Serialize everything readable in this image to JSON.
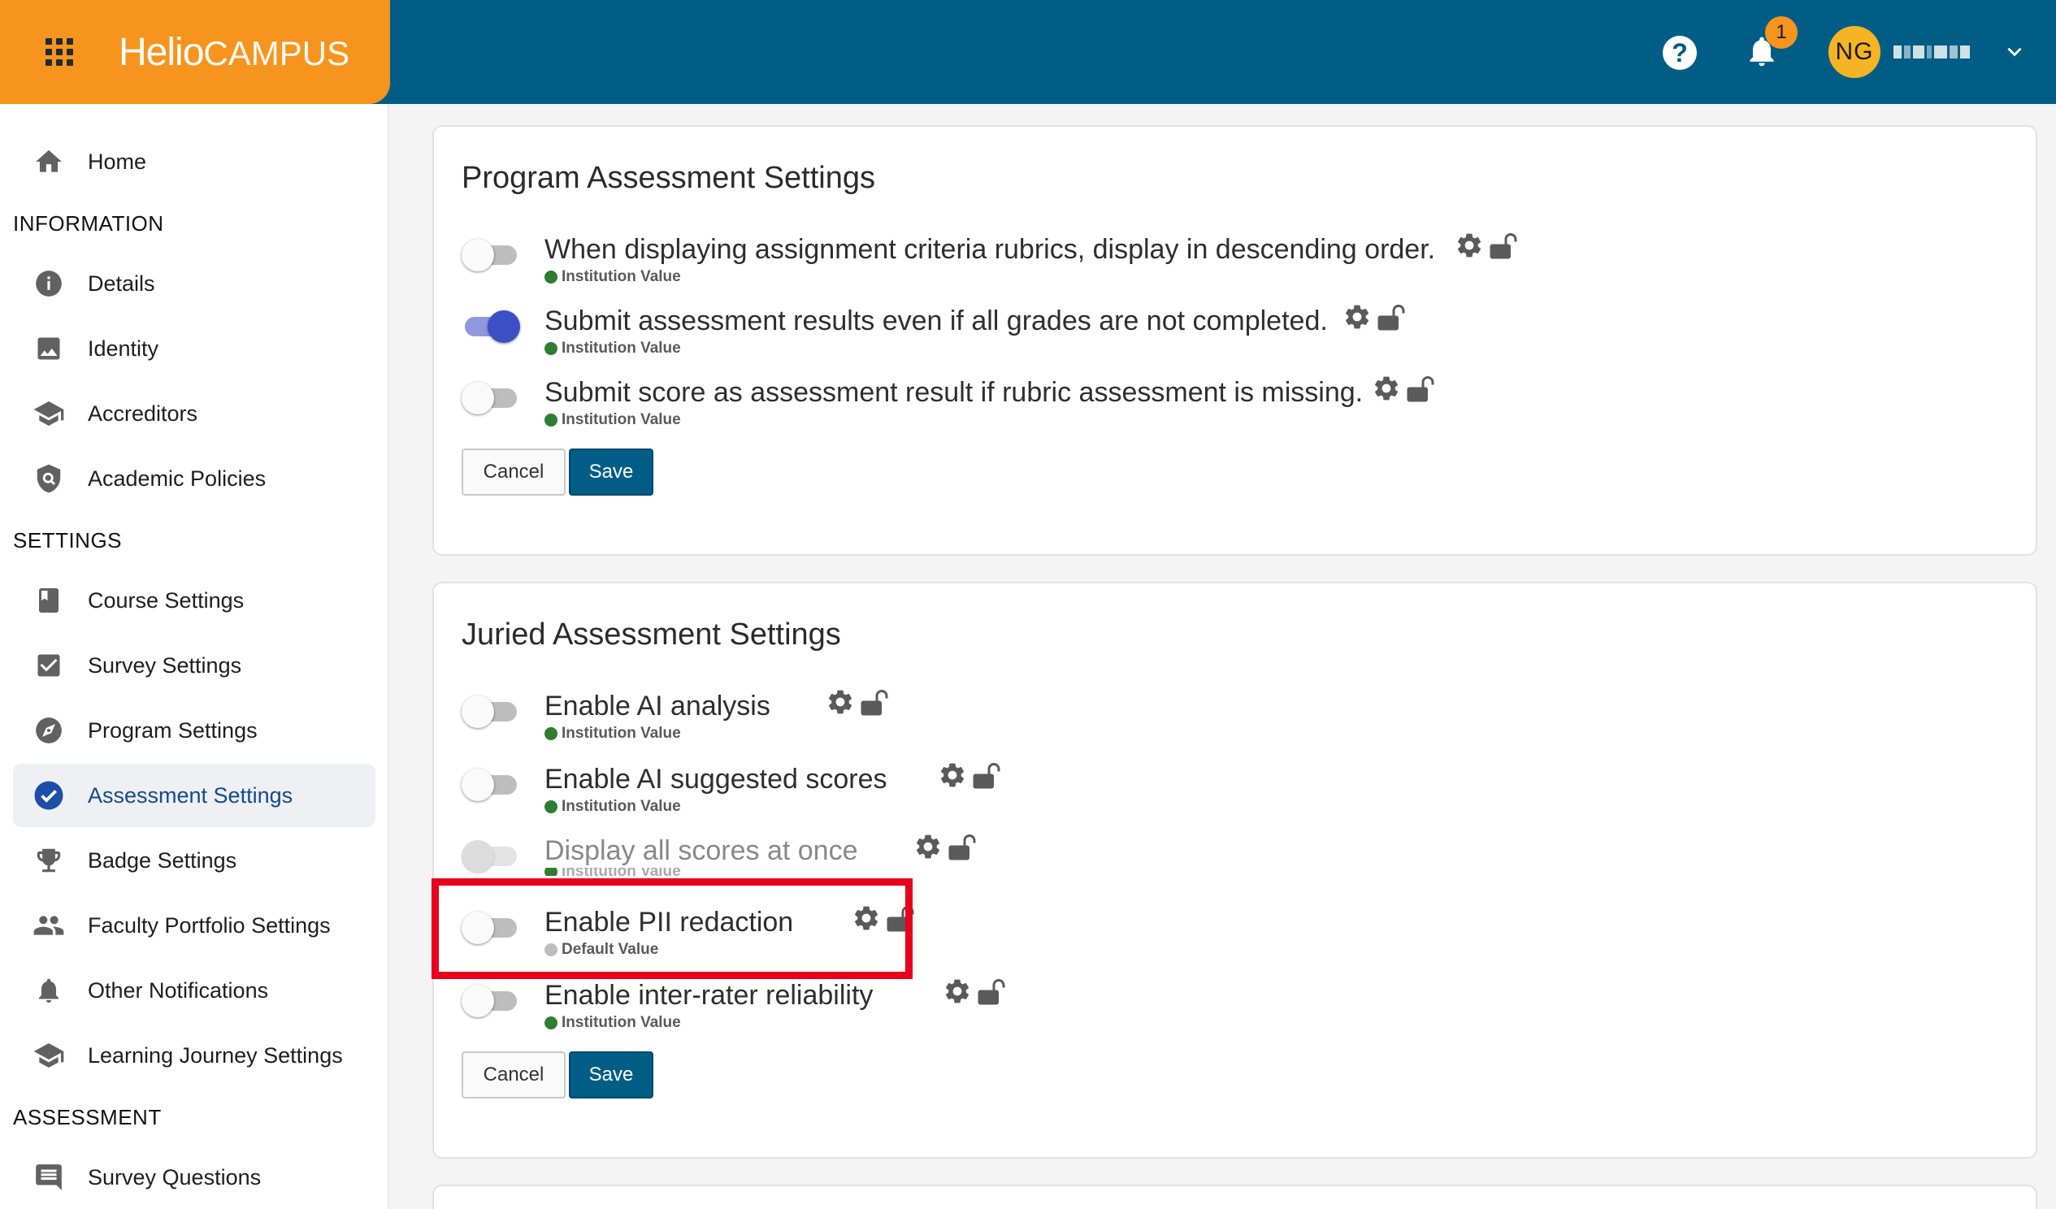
{
  "header": {
    "brand_part1": "Helio",
    "brand_part2": "CAMPUS",
    "notification_count": "1",
    "user_initials": "NG",
    "colors": {
      "header_bg": "#005d86",
      "brand_bg": "#f7941d"
    }
  },
  "sidebar": {
    "home": "Home",
    "sections": {
      "information": "INFORMATION",
      "settings": "SETTINGS",
      "assessment": "ASSESSMENT"
    },
    "information_items": [
      {
        "label": "Details",
        "icon": "info-icon"
      },
      {
        "label": "Identity",
        "icon": "image-icon"
      },
      {
        "label": "Accreditors",
        "icon": "school-icon"
      },
      {
        "label": "Academic Policies",
        "icon": "policy-shield-icon"
      }
    ],
    "settings_items": [
      {
        "label": "Course Settings",
        "icon": "book-icon"
      },
      {
        "label": "Survey Settings",
        "icon": "checkbox-icon"
      },
      {
        "label": "Program Settings",
        "icon": "compass-icon"
      },
      {
        "label": "Assessment Settings",
        "icon": "check-circle-icon",
        "active": true
      },
      {
        "label": "Badge Settings",
        "icon": "trophy-icon"
      },
      {
        "label": "Faculty Portfolio Settings",
        "icon": "people-icon"
      },
      {
        "label": "Other Notifications",
        "icon": "bell-icon"
      },
      {
        "label": "Learning Journey Settings",
        "icon": "school-icon"
      }
    ],
    "assessment_items": [
      {
        "label": "Survey Questions",
        "icon": "comment-icon"
      }
    ]
  },
  "program_card": {
    "title": "Program Assessment Settings",
    "settings": [
      {
        "label": "When displaying assignment criteria rubrics, display in descending order.",
        "source": "Institution Value",
        "enabled": false
      },
      {
        "label": "Submit assessment results even if all grades are not completed.",
        "source": "Institution Value",
        "enabled": true
      },
      {
        "label": "Submit score as assessment result if rubric assessment is missing.",
        "source": "Institution Value",
        "enabled": false
      }
    ],
    "cancel_label": "Cancel",
    "save_label": "Save"
  },
  "juried_card": {
    "title": "Juried Assessment Settings",
    "settings": [
      {
        "label": "Enable AI analysis",
        "source": "Institution Value",
        "enabled": false
      },
      {
        "label": "Enable AI suggested scores",
        "source": "Institution Value",
        "enabled": false
      },
      {
        "label": "Display all scores at once",
        "source": "Institution Value",
        "enabled": false,
        "disabled": true
      },
      {
        "label": "Enable PII redaction",
        "source": "Default Value",
        "enabled": false
      },
      {
        "label": "Enable inter-rater reliability",
        "source": "Institution Value",
        "enabled": false
      }
    ],
    "cancel_label": "Cancel",
    "save_label": "Save"
  }
}
